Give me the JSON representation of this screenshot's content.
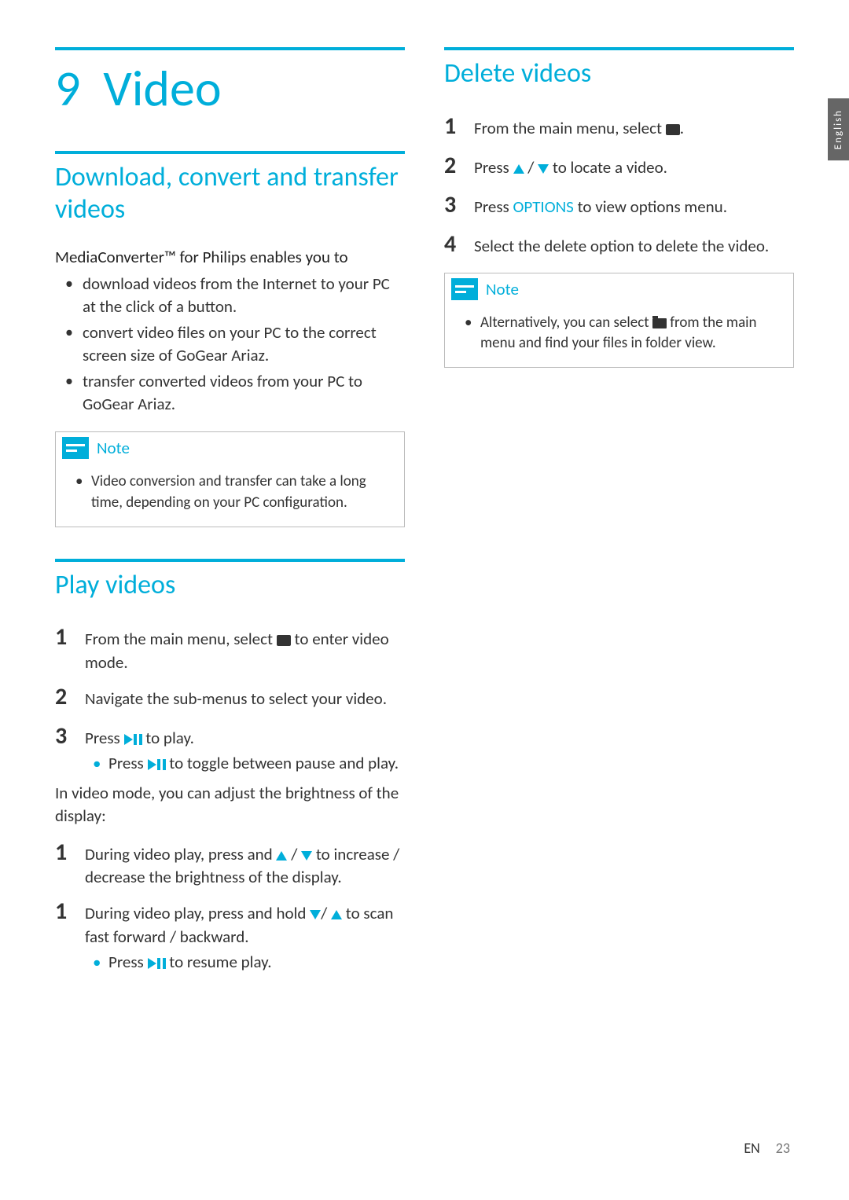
{
  "chapter": {
    "number": "9",
    "title": "Video"
  },
  "sideTab": "English",
  "footer": {
    "lang": "EN",
    "page": "23"
  },
  "section1": {
    "title": "Download, convert and transfer videos",
    "intro_prefix": "MediaConverter™",
    "intro_suffix": " for Philips enables you to",
    "bullets": [
      "download videos from the Internet to your PC at the click of a button.",
      "convert video files on your PC to the correct screen size of GoGear Ariaz.",
      "transfer converted videos from your PC to GoGear Ariaz."
    ],
    "note_label": "Note",
    "note_body": "Video conversion and transfer can take a long time, depending on your PC configuration."
  },
  "section2": {
    "title": "Play videos",
    "steps": [
      {
        "num": "1",
        "before": "From the main menu, select ",
        "after": " to enter video mode."
      },
      {
        "num": "2",
        "text": "Navigate the sub-menus to select your video."
      },
      {
        "num": "3",
        "before": "Press ",
        "after": " to play.",
        "sub_before": "Press ",
        "sub_after": " to toggle between pause and play."
      }
    ],
    "mid_text": "In video mode, you can adjust the brightness of the display:",
    "brightness": {
      "num": "1",
      "before": "During video play, press and ",
      "mid": " / ",
      "after": " to increase / decrease the brightness of the display."
    },
    "scan": {
      "num": "1",
      "before": "During video play, press and hold ",
      "mid": "/ ",
      "after": " to scan fast forward / backward.",
      "sub_before": "Press ",
      "sub_after": " to resume play."
    }
  },
  "section3": {
    "title": "Delete videos",
    "steps": {
      "s1": {
        "num": "1",
        "before": "From the main menu, select ",
        "after": "."
      },
      "s2": {
        "num": "2",
        "before": "Press ",
        "mid": " / ",
        "after": " to locate a video."
      },
      "s3": {
        "num": "3",
        "before": "Press ",
        "options": "OPTIONS",
        "after": " to view options menu."
      },
      "s4": {
        "num": "4",
        "text": "Select the delete option to delete the video."
      }
    },
    "note_label": "Note",
    "note_before": "Alternatively, you can select ",
    "note_after": " from the main menu and find your files in folder view."
  }
}
